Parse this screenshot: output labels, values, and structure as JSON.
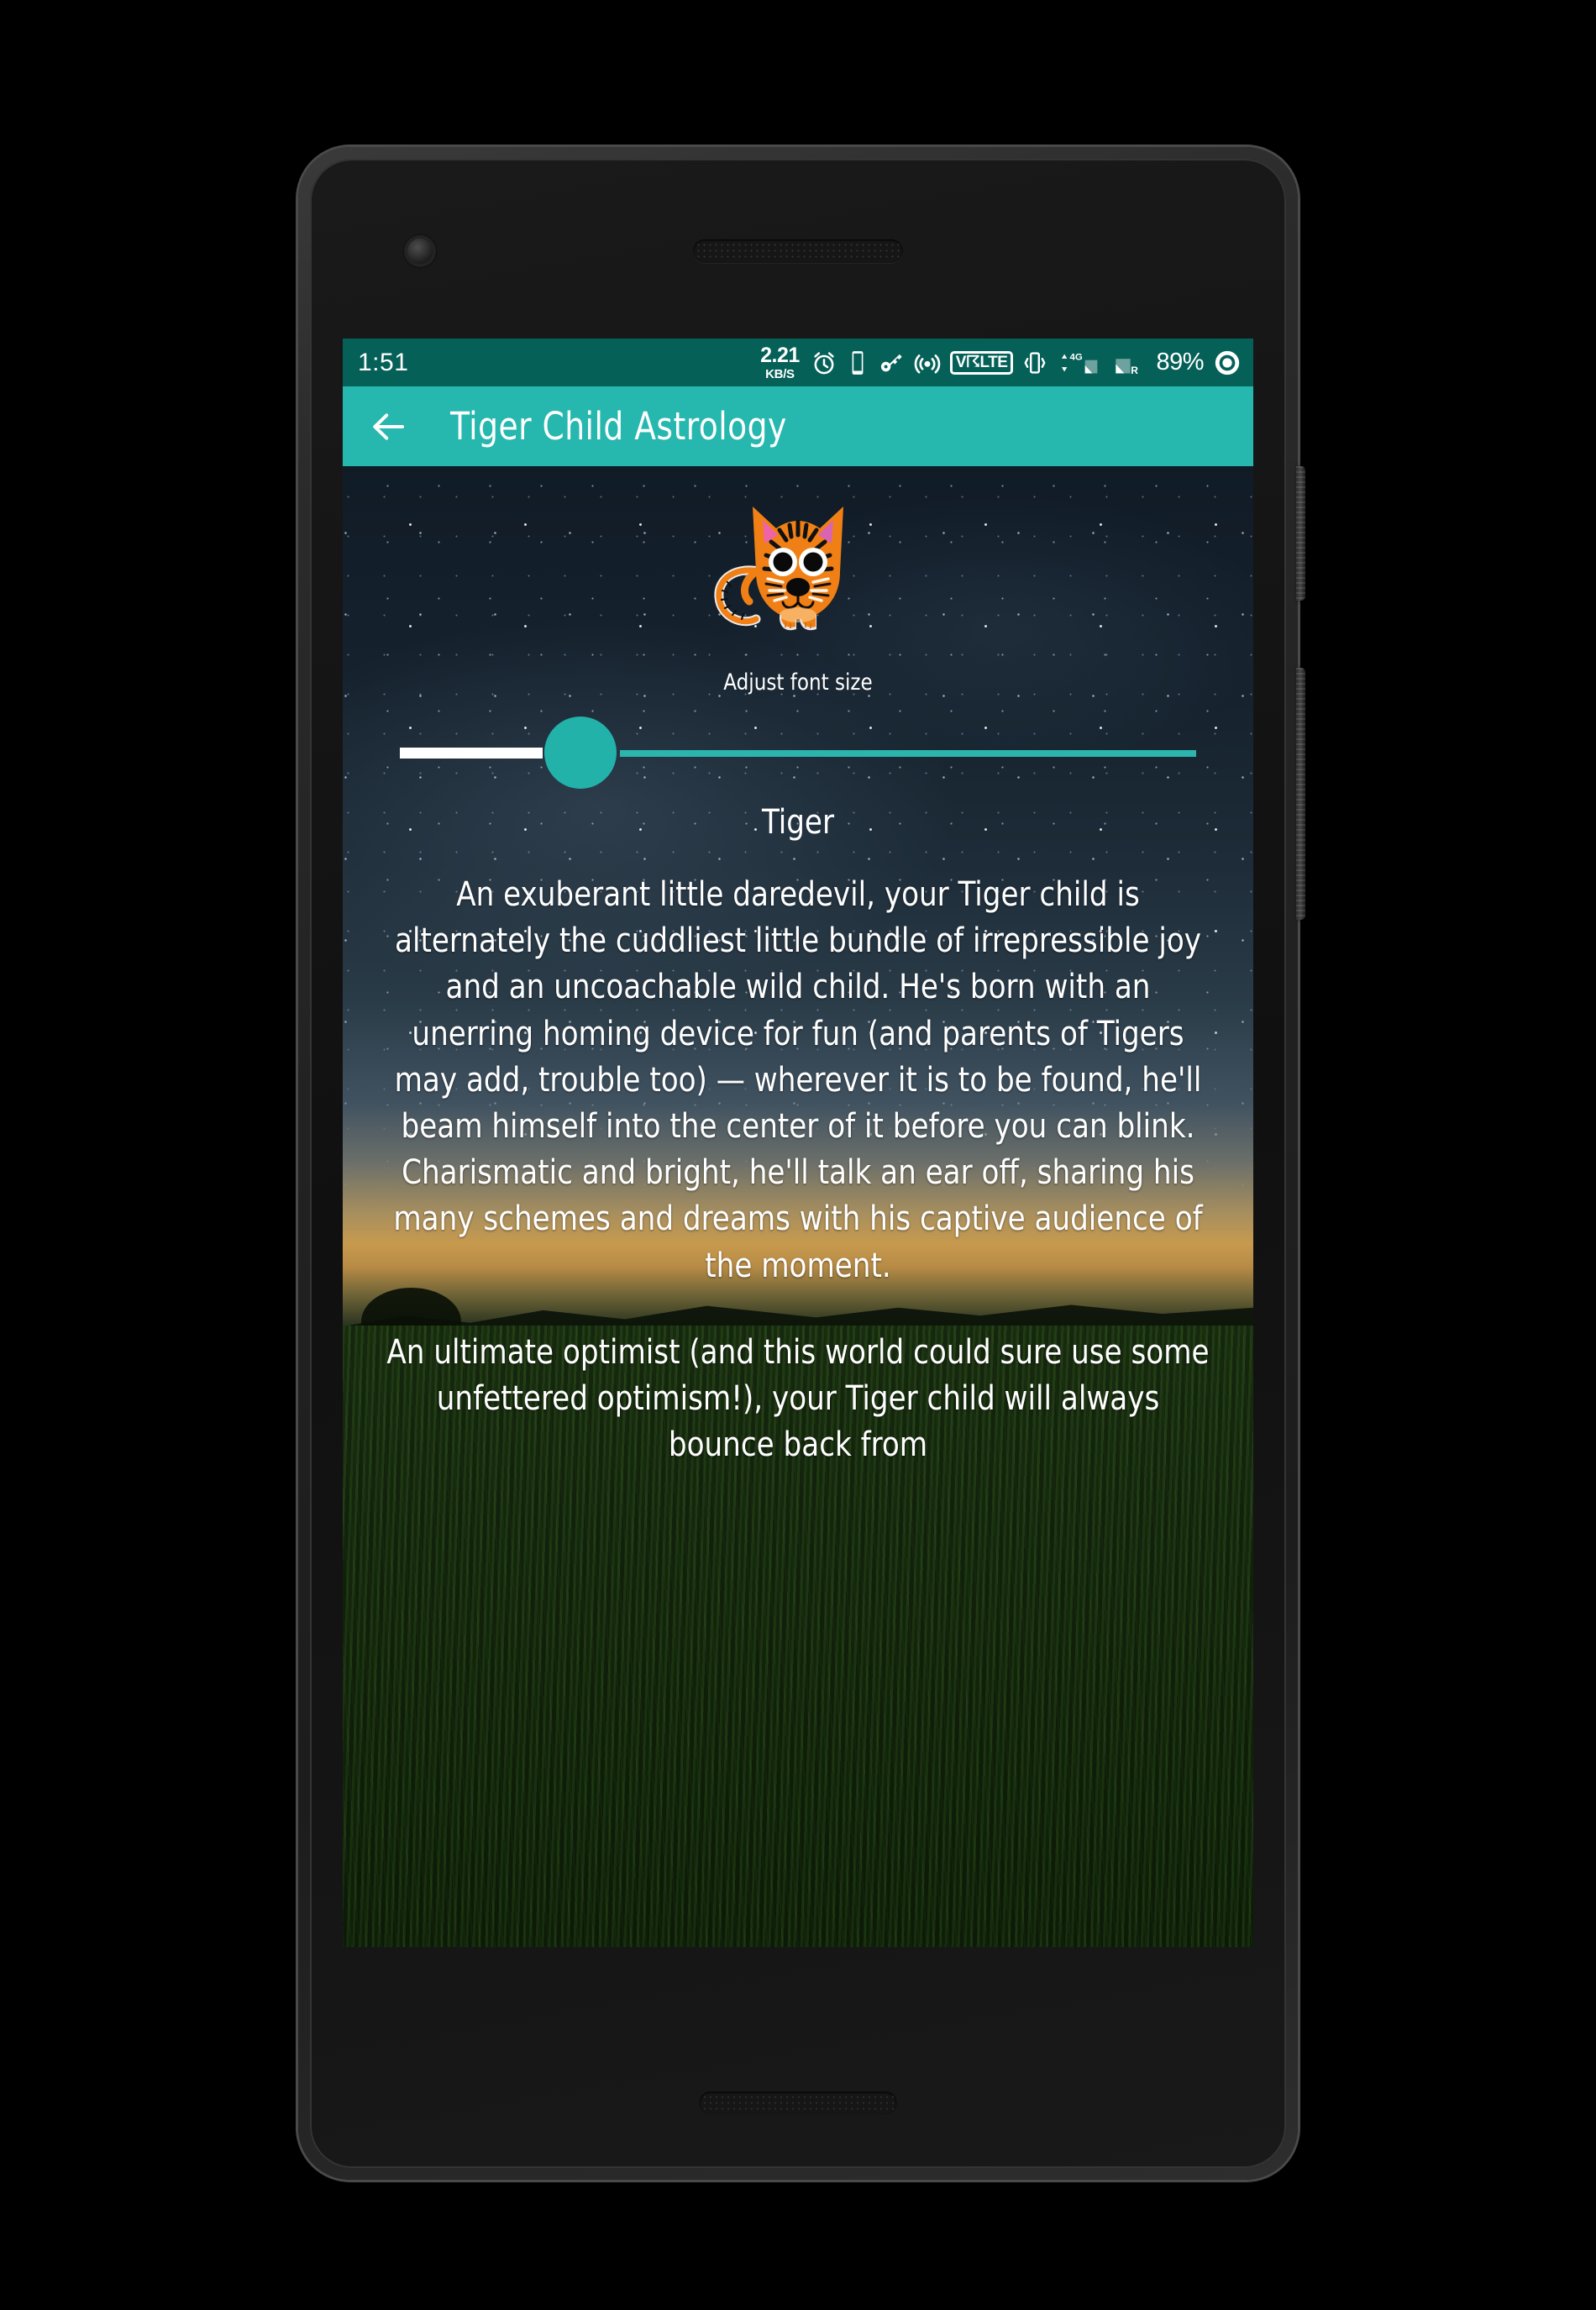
{
  "status_bar": {
    "time": "1:51",
    "data_rate_value": "2.21",
    "data_rate_unit": "KB/S",
    "alarm_icon": "alarm-clock-icon",
    "device_icon": "mobile-device-icon",
    "vpn_icon": "vpn-key-icon",
    "cast_icon": "hotspot-icon",
    "volte_label": "V☈LTE",
    "vibrate_icon": "vibrate-icon",
    "network_type": "4G",
    "roaming_label": "R",
    "battery_percent": "89%",
    "record_icon": "record-circle-icon",
    "background_color": "#056058"
  },
  "app_bar": {
    "back_icon": "back-arrow-icon",
    "title": "Tiger Child Astrology",
    "background_color": "#26b7ae",
    "text_color": "#ffffff"
  },
  "content": {
    "mascot_icon": "tiger-mascot-icon",
    "font_size_label": "Adjust font size",
    "slider": {
      "value_fraction": 0.24,
      "thumb_color": "#22b2aa",
      "left_track_color": "#ffffff",
      "right_track_color": "#2bb5ad"
    },
    "heading": "Tiger",
    "paragraphs": [
      "An exuberant little daredevil, your Tiger child is alternately the cuddliest little bundle of irrepressible joy and an uncoachable wild child. He's born with an unerring homing device for fun (and parents of Tigers may add, trouble too) — wherever it is to be found, he'll beam himself into the center of it before you can blink. Charismatic and bright, he'll talk an ear off, sharing his many schemes and dreams with his captive audience of the moment.",
      "An ultimate optimist (and this world could sure use some unfettered optimism!), your Tiger child will always bounce back from"
    ]
  },
  "device": {
    "front_camera": "front-camera-icon",
    "earpiece": "earpiece-speaker",
    "bottom_speaker": "bottom-speaker",
    "power_button": "power-button",
    "volume_button": "volume-rocker-button"
  }
}
